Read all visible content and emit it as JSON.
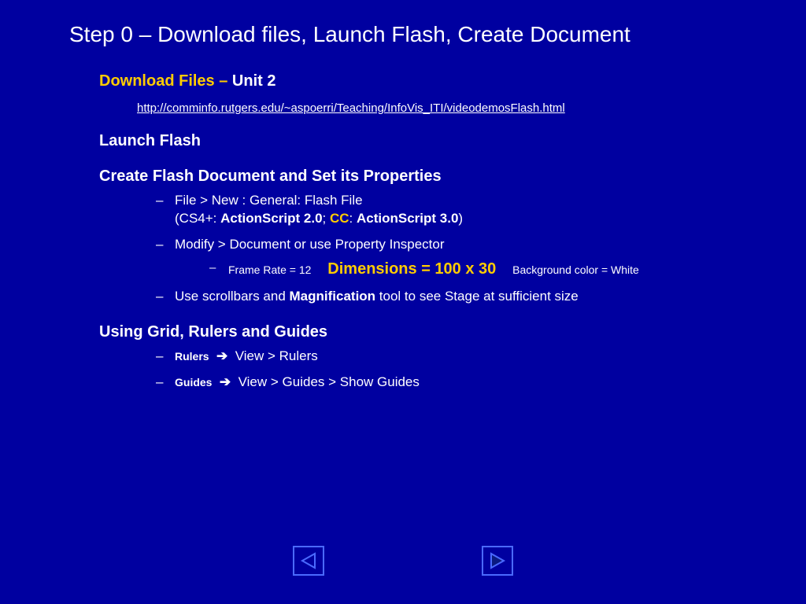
{
  "title": "Step 0 – Download files, Launch Flash, Create Document",
  "s1": {
    "heading_prefix": "Download Files – ",
    "heading_unit": "Unit 2",
    "url": "http://comminfo.rutgers.edu/~aspoerri/Teaching/InfoVis_ITI/videodemosFlash.html"
  },
  "s2": {
    "heading": "Launch Flash"
  },
  "s3": {
    "heading": "Create Flash Document and Set its Properties",
    "b1a": "File > New : General: Flash File",
    "b1b_pre": "(CS4+: ",
    "b1b_as2": "ActionScript 2.0",
    "b1b_mid": "; ",
    "b1b_cc": "CC",
    "b1b_mid2": ": ",
    "b1b_as3": "ActionScript 3.0",
    "b1b_post": ")",
    "b2": "Modify > Document   or   use Property Inspector",
    "b2s_fr": "Frame Rate = 12",
    "b2s_dim": "Dimensions = 100 x 30",
    "b2s_bg": "Background color = White",
    "b3a": "Use scrollbars and ",
    "b3b": "Magnification",
    "b3c": " tool to see Stage at sufficient size"
  },
  "s4": {
    "heading": "Using Grid, Rulers and Guides",
    "b1_label": "Rulers",
    "b1_path": "View > Rulers",
    "b2_label": "Guides",
    "b2_path": "View > Guides > Show Guides"
  },
  "arrow": "➔"
}
